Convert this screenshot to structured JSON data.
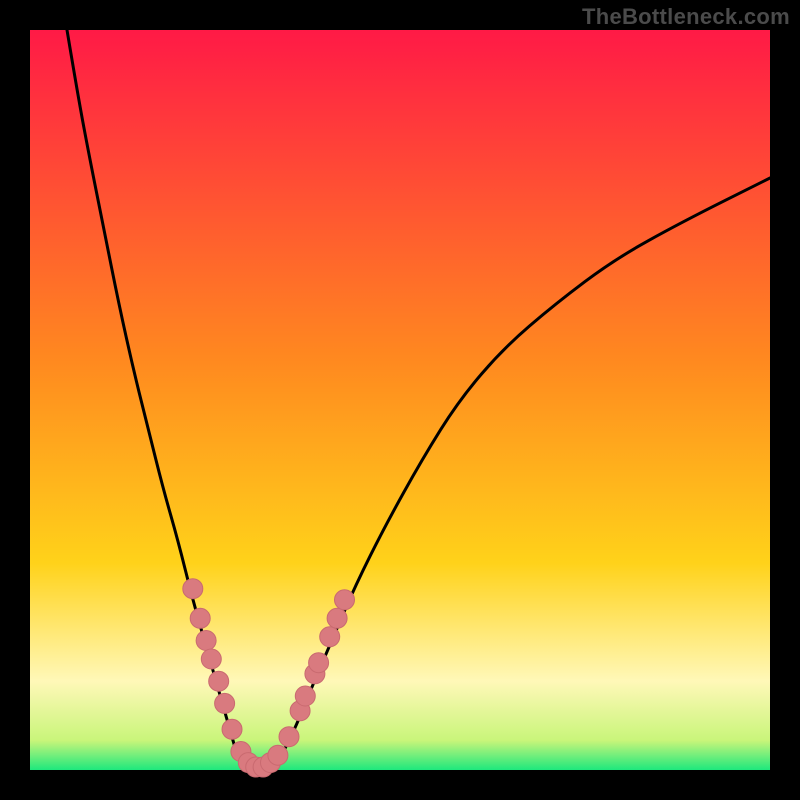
{
  "watermark": "TheBottleneck.com",
  "colors": {
    "frame": "#000000",
    "grad_top": "#ff1a46",
    "grad_mid": "#ffd21a",
    "grad_low": "#fff8b8",
    "grad_bottom": "#1ee87d",
    "curve": "#000000",
    "marker_fill": "#d97a7f",
    "marker_stroke": "#c96a70"
  },
  "chart_data": {
    "type": "line",
    "title": "",
    "xlabel": "",
    "ylabel": "",
    "xlim": [
      0,
      100
    ],
    "ylim": [
      0,
      100
    ],
    "series": [
      {
        "name": "left-branch",
        "x": [
          5,
          6.5,
          8,
          10,
          12,
          14,
          16,
          18,
          20,
          22,
          24,
          26,
          28
        ],
        "y": [
          100,
          91,
          83,
          73,
          63,
          54,
          46,
          38,
          31,
          23,
          16,
          9,
          2
        ]
      },
      {
        "name": "valley",
        "x": [
          28,
          29,
          30,
          31,
          32,
          33,
          34
        ],
        "y": [
          2,
          0.8,
          0.3,
          0.2,
          0.3,
          0.8,
          2
        ]
      },
      {
        "name": "right-branch",
        "x": [
          34,
          36,
          38,
          41,
          44,
          48,
          53,
          58,
          64,
          71,
          79,
          88,
          100
        ],
        "y": [
          2,
          6,
          11,
          18,
          25,
          33,
          42,
          50,
          57,
          63,
          69,
          74,
          80
        ]
      }
    ],
    "markers": [
      {
        "x": 22.0,
        "y": 24.5
      },
      {
        "x": 23.0,
        "y": 20.5
      },
      {
        "x": 23.8,
        "y": 17.5
      },
      {
        "x": 24.5,
        "y": 15.0
      },
      {
        "x": 25.5,
        "y": 12.0
      },
      {
        "x": 26.3,
        "y": 9.0
      },
      {
        "x": 27.3,
        "y": 5.5
      },
      {
        "x": 28.5,
        "y": 2.5
      },
      {
        "x": 29.5,
        "y": 1.0
      },
      {
        "x": 30.5,
        "y": 0.4
      },
      {
        "x": 31.5,
        "y": 0.4
      },
      {
        "x": 32.5,
        "y": 1.0
      },
      {
        "x": 33.5,
        "y": 2.0
      },
      {
        "x": 35.0,
        "y": 4.5
      },
      {
        "x": 36.5,
        "y": 8.0
      },
      {
        "x": 37.2,
        "y": 10.0
      },
      {
        "x": 38.5,
        "y": 13.0
      },
      {
        "x": 39.0,
        "y": 14.5
      },
      {
        "x": 40.5,
        "y": 18.0
      },
      {
        "x": 41.5,
        "y": 20.5
      },
      {
        "x": 42.5,
        "y": 23.0
      }
    ]
  }
}
